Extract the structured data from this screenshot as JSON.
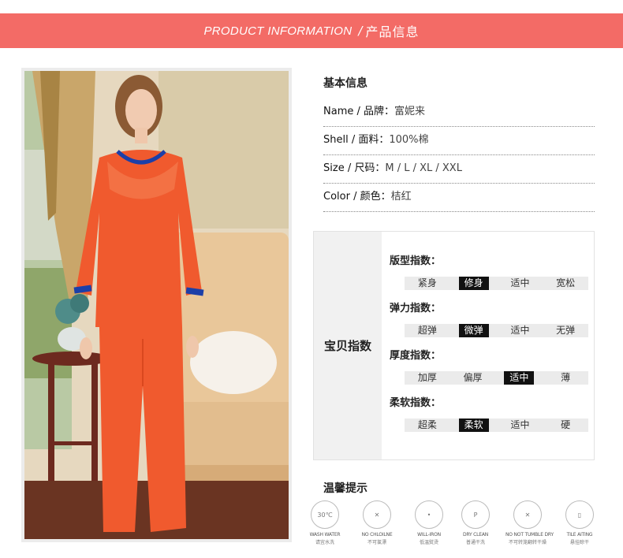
{
  "banner": {
    "en": "PRODUCT INFORMATION",
    "sep": "/",
    "zh": "产品信息"
  },
  "colors": {
    "banner": "#f36b66",
    "selected": "#111111",
    "bar": "#ebebeb",
    "pajama": "#f05a2e",
    "trim": "#1c3fa8"
  },
  "basic": {
    "title": "基本信息",
    "rows": [
      {
        "label": "Name / 品牌：",
        "value": "富妮来"
      },
      {
        "label": "Shell / 面料：",
        "value": "100%棉"
      },
      {
        "label": "Size / 尺码：",
        "value": "M / L / XL / XXL"
      },
      {
        "label": "Color / 颜色：",
        "value": "桔红"
      }
    ]
  },
  "index": {
    "title": "宝贝指数",
    "groups": [
      {
        "name": "版型指数：",
        "options": [
          "紧身",
          "修身",
          "适中",
          "宽松"
        ],
        "selected": 1
      },
      {
        "name": "弹力指数：",
        "options": [
          "超弹",
          "微弹",
          "适中",
          "无弹"
        ],
        "selected": 1
      },
      {
        "name": "厚度指数：",
        "options": [
          "加厚",
          "偏厚",
          "适中",
          "薄"
        ],
        "selected": 2
      },
      {
        "name": "柔软指数：",
        "options": [
          "超柔",
          "柔软",
          "适中",
          "硬"
        ],
        "selected": 1
      }
    ]
  },
  "care": {
    "title": "温馨提示",
    "items": [
      {
        "icon": "wash-30-icon",
        "en": "WASH WATER",
        "zh": "请宜水洗",
        "glyph": "30℃"
      },
      {
        "icon": "no-bleach-icon",
        "en": "NO CHLOILNE",
        "zh": "不可氯漂",
        "glyph": "✕"
      },
      {
        "icon": "low-iron-icon",
        "en": "WILL-IRON",
        "zh": "低温熨烫",
        "glyph": "•"
      },
      {
        "icon": "dry-clean-icon",
        "en": "DRY CLEAN",
        "zh": "普通干洗",
        "glyph": "P"
      },
      {
        "icon": "no-tumble-dry-icon",
        "en": "NO NOT TUMBLE DRY",
        "zh": "不可转笼翻转干燥",
        "glyph": "✕"
      },
      {
        "icon": "tile-dry-icon",
        "en": "TILE AITING",
        "zh": "悬挂晾干",
        "glyph": "▯"
      }
    ]
  }
}
